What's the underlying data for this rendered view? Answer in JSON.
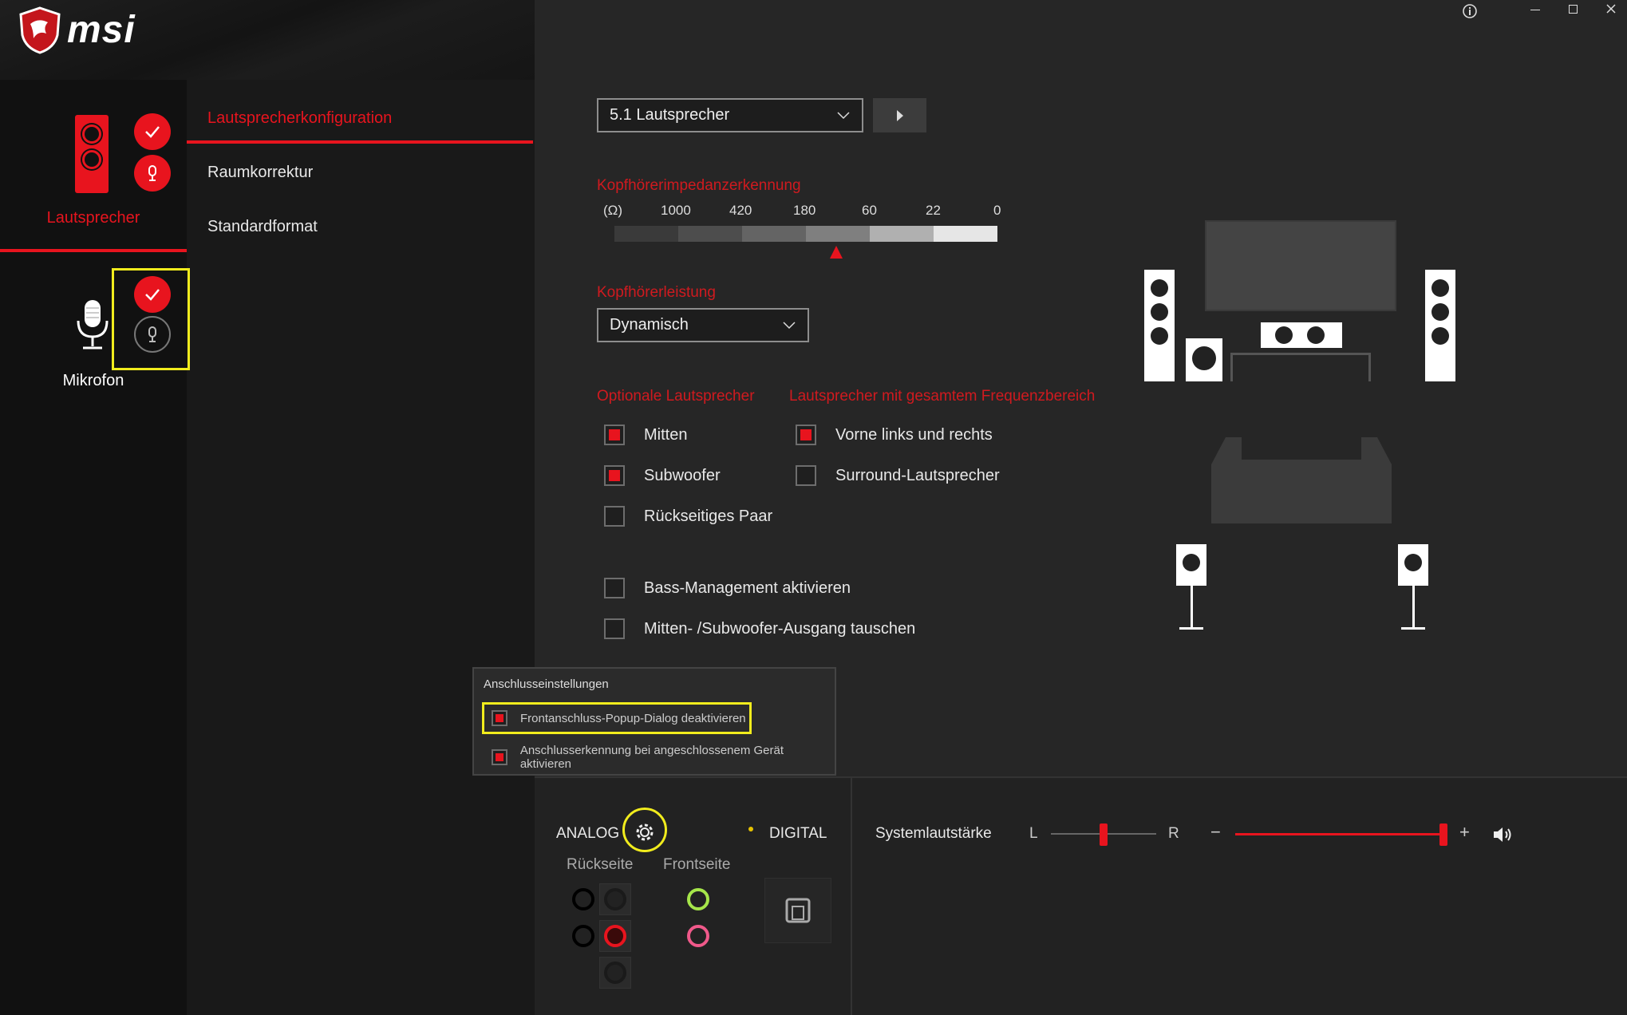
{
  "window": {
    "brand": "msi",
    "controls": {
      "info": "info-icon",
      "minimize": "minimize-icon",
      "maximize": "maximize-icon",
      "close": "close-icon"
    }
  },
  "devices": [
    {
      "label": "Lautsprecher",
      "active": true
    },
    {
      "label": "Mikrofon",
      "active": false
    }
  ],
  "nav": {
    "items": [
      "Lautsprecherkonfiguration",
      "Raumkorrektur",
      "Standardformat"
    ],
    "active_index": 0
  },
  "speaker_config": {
    "selected": "5.1 Lautsprecher"
  },
  "impedance": {
    "title": "Kopfhörerimpedanzerkennung",
    "unit_label": "(Ω)",
    "ticks": [
      "1000",
      "420",
      "180",
      "60",
      "22",
      "0"
    ]
  },
  "headphone_power": {
    "title": "Kopfhörerleistung",
    "selected": "Dynamisch"
  },
  "optional_speakers": {
    "title": "Optionale Lautsprecher",
    "items": [
      {
        "label": "Mitten",
        "checked": true
      },
      {
        "label": "Subwoofer",
        "checked": true
      },
      {
        "label": "Rückseitiges Paar",
        "checked": false
      }
    ]
  },
  "fullrange_speakers": {
    "title": "Lautsprecher mit gesamtem Frequenzbereich",
    "items": [
      {
        "label": "Vorne links und rechts",
        "checked": true
      },
      {
        "label": "Surround-Lautsprecher",
        "checked": false
      }
    ]
  },
  "extra_options": {
    "items": [
      {
        "label": "Bass-Management aktivieren",
        "checked": false
      },
      {
        "label": "Mitten- /Subwoofer-Ausgang tauschen",
        "checked": false
      }
    ]
  },
  "popup": {
    "title": "Anschlusseinstellungen",
    "items": [
      {
        "label": "Frontanschluss-Popup-Dialog deaktivieren",
        "checked": true
      },
      {
        "label": "Anschlusserkennung bei angeschlossenem Gerät aktivieren",
        "checked": true
      }
    ]
  },
  "jacks": {
    "analog_label": "ANALOG",
    "digital_label": "DIGITAL",
    "rear_label": "Rückseite",
    "front_label": "Frontseite",
    "colors": {
      "front_green": "#a6e64a",
      "front_pink": "#f0598a",
      "rear_red": "#e8141e"
    }
  },
  "volume": {
    "label": "Systemlautstärke",
    "balance_left": "L",
    "balance_right": "R",
    "minus": "−",
    "plus": "+",
    "level": 1.0
  },
  "colors": {
    "accent": "#e8141e",
    "highlight": "#f1ec1d"
  }
}
